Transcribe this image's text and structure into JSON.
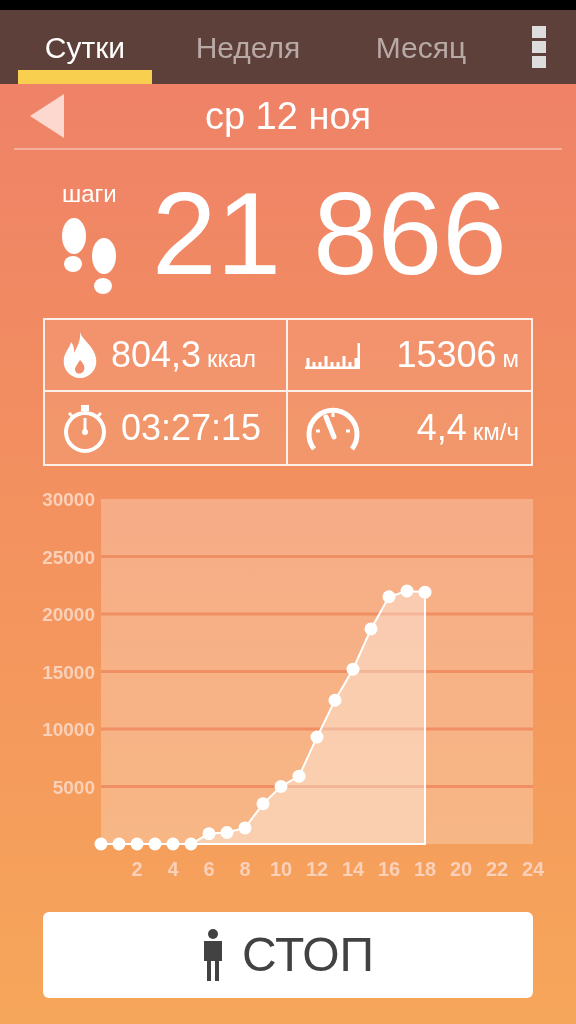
{
  "tabs": [
    {
      "label": "Сутки",
      "selected": true
    },
    {
      "label": "Неделя",
      "selected": false
    },
    {
      "label": "Месяц",
      "selected": false
    }
  ],
  "date": "ср 12 ноя",
  "steps": {
    "label": "шаги",
    "value": "21 866"
  },
  "stats": [
    {
      "kind": "calories",
      "value": "804,3",
      "unit": "ккал"
    },
    {
      "kind": "distance",
      "value": "15306",
      "unit": "м"
    },
    {
      "kind": "duration",
      "value": "03:27:15"
    },
    {
      "kind": "speed",
      "value": "4,4",
      "unit": "км/ч"
    }
  ],
  "chart": {
    "chart_data": {
      "type": "area",
      "x": [
        0,
        1,
        2,
        3,
        4,
        5,
        6,
        7,
        8,
        9,
        10,
        11,
        12,
        13,
        14,
        15,
        16,
        17,
        18
      ],
      "series": [
        {
          "color": "#ffffff",
          "values": [
            0,
            0,
            0,
            0,
            0,
            0,
            900,
            1000,
            1400,
            3500,
            5000,
            5900,
            9300,
            12500,
            15200,
            18700,
            21500,
            22000,
            21900
          ]
        }
      ],
      "grid": true,
      "xlim": [
        0,
        24
      ],
      "ylim": [
        0,
        30000
      ],
      "xticks": [
        2,
        4,
        6,
        8,
        10,
        12,
        14,
        16,
        18,
        20,
        22,
        24
      ],
      "yticks": [
        5000,
        10000,
        15000,
        20000,
        25000,
        30000
      ]
    }
  },
  "stop_button": {
    "label": "СТОП"
  }
}
